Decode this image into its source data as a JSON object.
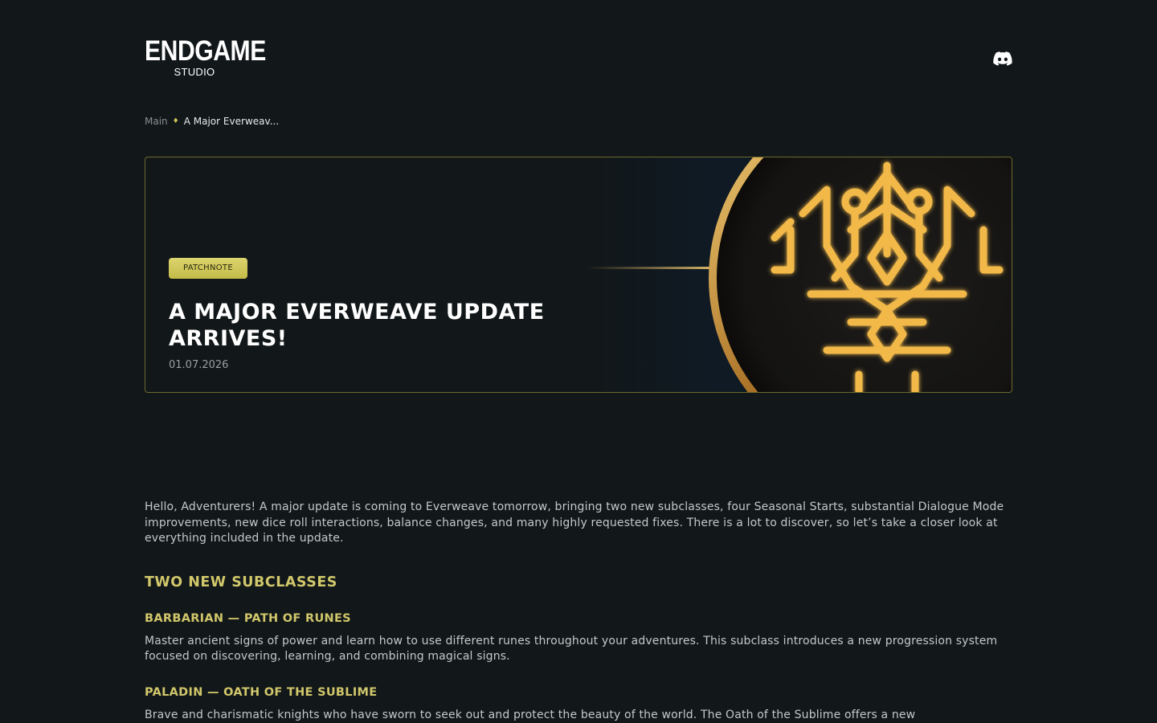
{
  "header": {
    "logo_main": "ENDGAME",
    "logo_sub": "STUDIO",
    "discord_icon": "discord-icon"
  },
  "breadcrumb": {
    "root": "Main",
    "separator": "♦",
    "current": "A Major Everweav..."
  },
  "hero": {
    "badge": "PATCHNOTE",
    "title": "A MAJOR EVERWEAVE UPDATE ARRIVES!",
    "date": "01.07.2026",
    "accent_color": "#d1c76b"
  },
  "article": {
    "intro": "Hello, Adventurers! A major update is coming to Everweave tomorrow, bringing two new subclasses, four Seasonal Starts, substantial Dialogue Mode improvements, new dice roll interactions, balance changes, and many highly requested fixes. There is a lot to discover, so let’s take a closer look at everything included in the update.",
    "section_title": "TWO NEW SUBCLASSES",
    "subclasses": [
      {
        "title": "BARBARIAN — PATH OF RUNES",
        "text": "Master ancient signs of power and learn how to use different runes throughout your adventures. This subclass introduces a new progression system focused on discovering, learning, and combining magical signs."
      },
      {
        "title": "PALADIN — OATH OF THE SUBLIME",
        "text": "Brave and charismatic knights who have sworn to seek out and protect the beauty of the world. The Oath of the Sublime offers a new"
      }
    ]
  }
}
